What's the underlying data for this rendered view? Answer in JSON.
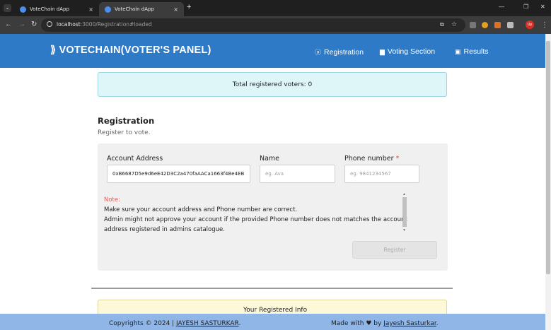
{
  "browser": {
    "tabs": [
      {
        "title": "VoteChain dApp",
        "close": "×"
      },
      {
        "title": "VoteChain dApp",
        "close": "×"
      }
    ],
    "new_tab": "+",
    "url_host": "localhost",
    "url_path": ":3000/Registration#loaded",
    "profile_label": "Up"
  },
  "header": {
    "brand": "VOTECHAIN(VOTER'S PANEL)",
    "nav": [
      {
        "label": "Registration",
        "icon": "registration-icon"
      },
      {
        "label": "Voting Section",
        "icon": "voting-icon"
      },
      {
        "label": "Results",
        "icon": "results-icon"
      }
    ]
  },
  "alert": {
    "text": "Total registered voters: 0"
  },
  "registration": {
    "title": "Registration",
    "subtitle": "Register to vote.",
    "account_label": "Account Address",
    "account_value": "0xB6687D5e9d6eE42D3C2a470faAACa1663f4Be4EB",
    "name_label": "Name",
    "name_placeholder": "eg. Ava",
    "phone_label": "Phone number",
    "phone_required": "*",
    "phone_placeholder": "eg. 9841234567",
    "note_head": "Note:",
    "note_lines": [
      "Make sure your account address and Phone number are correct.",
      "Admin might not approve your account if the provided Phone number does not matches the account",
      "address registered in admins catalogue."
    ],
    "register_button": "Register"
  },
  "info": {
    "title": "Your Registered Info"
  },
  "footer": {
    "left_prefix": "Copyrights © 2024 | ",
    "left_link": "JAYESH SASTURKAR",
    "left_suffix": ".",
    "right_prefix": "Made with ♥ by ",
    "right_link": "Jayesh Sasturkar",
    "right_suffix": "."
  },
  "colors": {
    "header": "#2f7ac6",
    "footer": "#8fb6e6",
    "alert_bg": "#dff6f8",
    "info_bg": "#fdf8d8",
    "note": "#e06060"
  }
}
